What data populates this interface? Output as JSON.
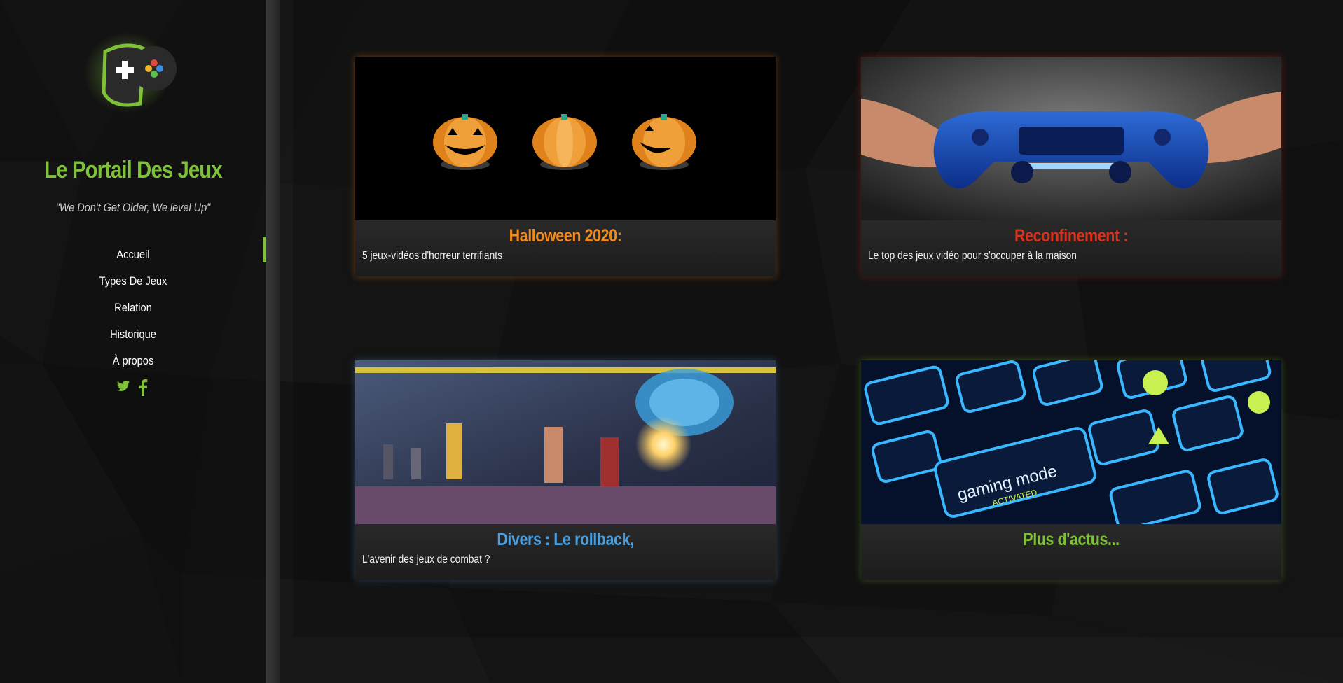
{
  "site": {
    "title": "Le Portail Des Jeux",
    "tagline": "\"We Don't Get Older, We level Up\"",
    "logo_icon": "gamepad-logo",
    "accent_color": "#7fc23a"
  },
  "nav": {
    "items": [
      {
        "label": "Accueil",
        "active": true
      },
      {
        "label": "Types De Jeux",
        "active": false
      },
      {
        "label": "Relation",
        "active": false
      },
      {
        "label": "Historique",
        "active": false
      },
      {
        "label": "À propos",
        "active": false
      }
    ]
  },
  "social": {
    "icons": [
      "twitter-icon",
      "facebook-icon"
    ],
    "color": "#7fc23a"
  },
  "cards": [
    {
      "title": "Halloween 2020:",
      "subtitle": "5 jeux-vidéos d'horreur terrifiants",
      "color": "#f08a1c",
      "image": "pixel-pumpkins"
    },
    {
      "title": "Reconfinement :",
      "subtitle": "Le top des jeux vidéo pour s'occuper à la maison",
      "color": "#d8321c",
      "image": "blue-gamepad-hands"
    },
    {
      "title": "Divers : Le rollback,",
      "subtitle": "L'avenir des jeux de combat ?",
      "color": "#4a9fe0",
      "image": "fighting-game-brain"
    },
    {
      "title": "Plus d'actus...",
      "subtitle": "",
      "color": "#7fc23a",
      "image": "gaming-mode-keyboard"
    }
  ]
}
